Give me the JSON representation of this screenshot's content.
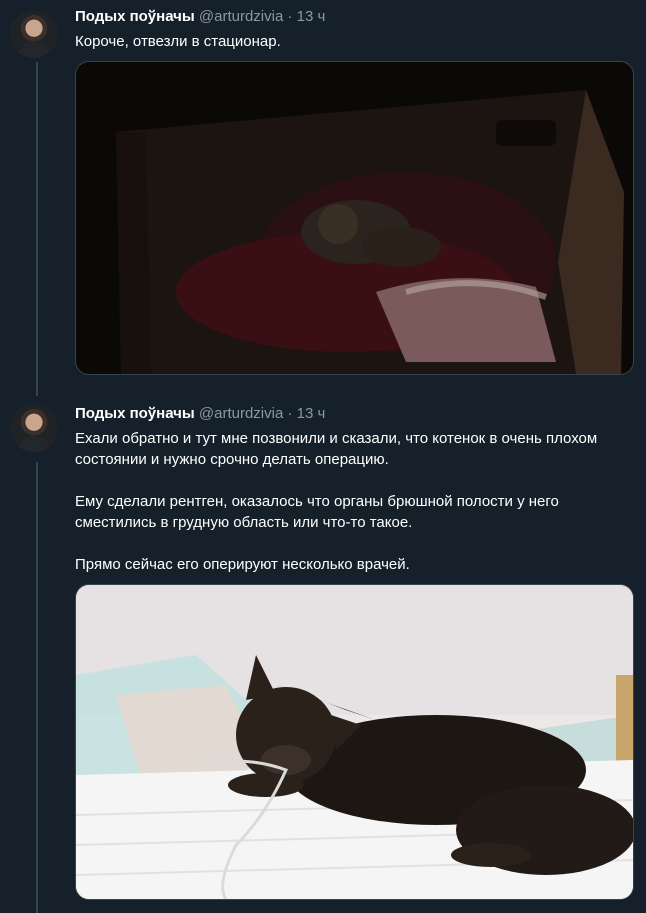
{
  "tweets": [
    {
      "author_name": "Подых поўначы",
      "handle": "@arturdzivia",
      "separator": "·",
      "time": "13 ч",
      "paragraphs": [
        "Короче, отвезли в стационар."
      ],
      "media": "photo-kitten-in-box-dark"
    },
    {
      "author_name": "Подых поўначы",
      "handle": "@arturdzivia",
      "separator": "·",
      "time": "13 ч",
      "paragraphs": [
        "Ехали обратно и тут мне позвонили и сказали, что котенок в очень плохом состоянии и нужно срочно делать операцию.",
        "Ему сделали рентген, оказалось что органы брюшной полости у него сместились в грудную область или что-то такое.",
        "Прямо сейчас его оперируют несколько врачей."
      ],
      "media": "photo-kitten-on-pad-with-iv"
    }
  ],
  "colors": {
    "background": "#15202b",
    "border": "#38444d",
    "secondary_text": "#8899a6",
    "primary_text": "#ffffff"
  }
}
